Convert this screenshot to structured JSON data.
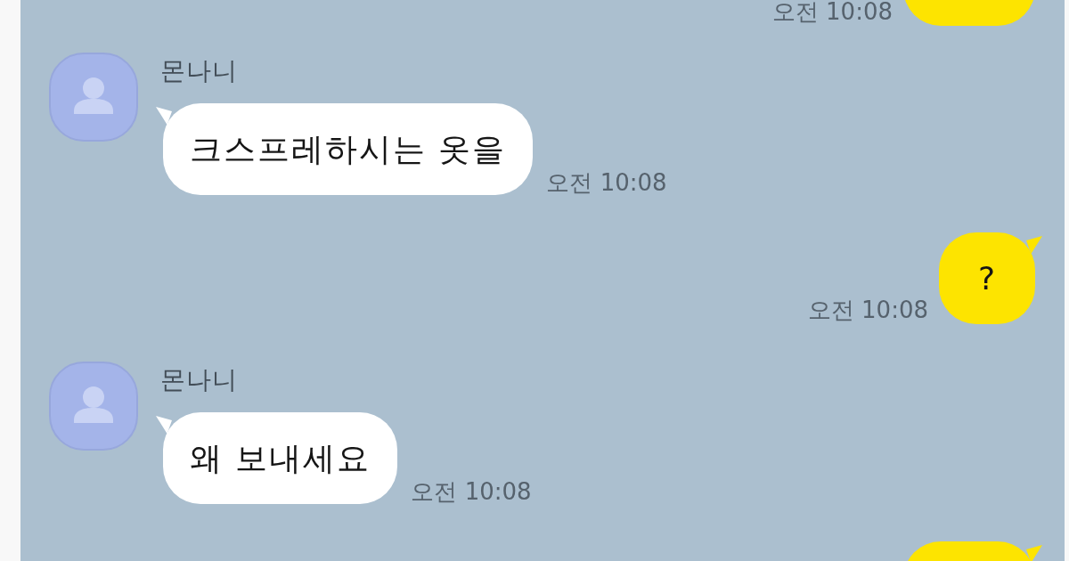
{
  "messages": [
    {
      "kind": "outgoing",
      "time": "오전 10:08"
    },
    {
      "kind": "incoming",
      "sender": "몬나니",
      "text": "크스프레하시는 옷을",
      "time": "오전 10:08"
    },
    {
      "kind": "outgoing",
      "text": "?",
      "time": "오전 10:08"
    },
    {
      "kind": "incoming",
      "sender": "몬나니",
      "text": "왜 보내세요",
      "time": "오전 10:08"
    },
    {
      "kind": "outgoing"
    }
  ]
}
